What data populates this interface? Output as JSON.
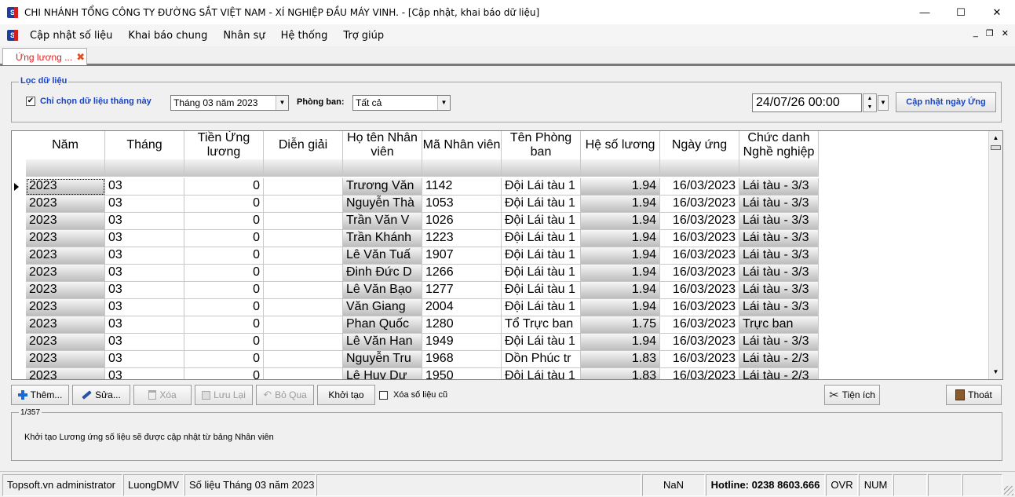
{
  "window": {
    "title": "CHI NHÁNH TỔNG CÔNG TY ĐƯỜNG SẮT VIỆT NAM - XÍ NGHIỆP ĐẦU MÁY VINH.  - [Cập nhật, khai báo dữ liệu]",
    "app_icon_text": "S",
    "minimize": "—",
    "maximize": "☐",
    "close": "✕"
  },
  "menu": {
    "items": [
      "Cập nhật số liệu",
      "Khai báo chung",
      "Nhân sự",
      "Hệ thống",
      "Trợ giúp"
    ],
    "mdi_minimize": "_",
    "mdi_restore": "❐",
    "mdi_close": "✕"
  },
  "tab": {
    "label": "Ứng lương ...",
    "close": "✖"
  },
  "filter": {
    "legend": "Lọc dữ liệu",
    "only_this_month_label": "Chỉ chọn dữ liệu tháng này",
    "only_this_month_checked": "✔",
    "month_value": "Tháng 03 năm 2023",
    "department_label": "Phòng ban:",
    "department_value": "Tất cả",
    "datetime_value": "24/07/26 00:00",
    "update_date_button": "Cập nhật ngày Ứng"
  },
  "grid": {
    "columns": [
      "Năm",
      "Tháng",
      "Tiền Ứng lương",
      "Diễn giải",
      "Họ tên Nhân viên",
      "Mã Nhân viên",
      "Tên Phòng ban",
      "Hệ số lương",
      "Ngày ứng",
      "Chức danh Nghề nghiệp"
    ],
    "rows": [
      [
        "2023",
        "03",
        "0",
        "",
        "Trương Văn",
        "1142",
        "Đội Lái tàu 1",
        "1.94",
        "16/03/2023",
        "Lái tàu - 3/3"
      ],
      [
        "2023",
        "03",
        "0",
        "",
        "Nguyễn Thà",
        "1053",
        "Đội Lái tàu 1",
        "1.94",
        "16/03/2023",
        "Lái tàu - 3/3"
      ],
      [
        "2023",
        "03",
        "0",
        "",
        "Trần Văn  V",
        "1026",
        "Đội Lái tàu 1",
        "1.94",
        "16/03/2023",
        "Lái tàu - 3/3"
      ],
      [
        "2023",
        "03",
        "0",
        "",
        "Trần Khánh",
        "1223",
        "Đội Lái tàu 1",
        "1.94",
        "16/03/2023",
        "Lái tàu - 3/3"
      ],
      [
        "2023",
        "03",
        "0",
        "",
        "Lê Văn  Tuấ",
        "1907",
        "Đội Lái tàu 1",
        "1.94",
        "16/03/2023",
        "Lái tàu - 3/3"
      ],
      [
        "2023",
        "03",
        "0",
        "",
        "Đinh Đức  D",
        "1266",
        "Đội Lái tàu 1",
        "1.94",
        "16/03/2023",
        "Lái tàu - 3/3"
      ],
      [
        "2023",
        "03",
        "0",
        "",
        "Lê Văn  Bạo",
        "1277",
        "Đội Lái tàu 1",
        "1.94",
        "16/03/2023",
        "Lái tàu - 3/3"
      ],
      [
        "2023",
        "03",
        "0",
        "",
        "Văn Giang",
        "2004",
        "Đội Lái tàu 1",
        "1.94",
        "16/03/2023",
        "Lái tàu - 3/3"
      ],
      [
        "2023",
        "03",
        "0",
        "",
        "Phan Quốc",
        "1280",
        "Tổ Trực ban",
        "1.75",
        "16/03/2023",
        "Trực ban"
      ],
      [
        "2023",
        "03",
        "0",
        "",
        "Lê Văn  Han",
        "1949",
        "Đội Lái tàu 1",
        "1.94",
        "16/03/2023",
        "Lái tàu - 3/3"
      ],
      [
        "2023",
        "03",
        "0",
        "",
        "Nguyễn Tru",
        "1968",
        "Dồn Phúc tr",
        "1.83",
        "16/03/2023",
        "Lái tàu - 2/3"
      ],
      [
        "2023",
        "03",
        "0",
        "",
        "Lê Huy  Dư",
        "1950",
        "Đội Lái tàu 1",
        "1.83",
        "16/03/2023",
        "Lái tàu - 2/3"
      ]
    ]
  },
  "toolbar": {
    "add": "Thêm...",
    "edit": "Sửa...",
    "delete": "Xóa",
    "save": "Lưu Lại",
    "cancel": "Bỏ Qua",
    "init": "Khởi tạo",
    "delete_old_label": "Xóa số liệu cũ",
    "utilities": "Tiện ích",
    "exit": "Thoát"
  },
  "info": {
    "record_count": "1/357",
    "message": "Khởi tạo Lương ứng số liệu sẽ được cập nhật từ bảng Nhân viên"
  },
  "status": {
    "user": "Topsoft.vn administrator",
    "database": "LuongDMV",
    "period": "Số liệu Tháng 03 năm 2023",
    "nan": "NaN",
    "hotline": "Hotline: 0238 8603.666",
    "ovr": "OVR",
    "num": "NUM"
  }
}
